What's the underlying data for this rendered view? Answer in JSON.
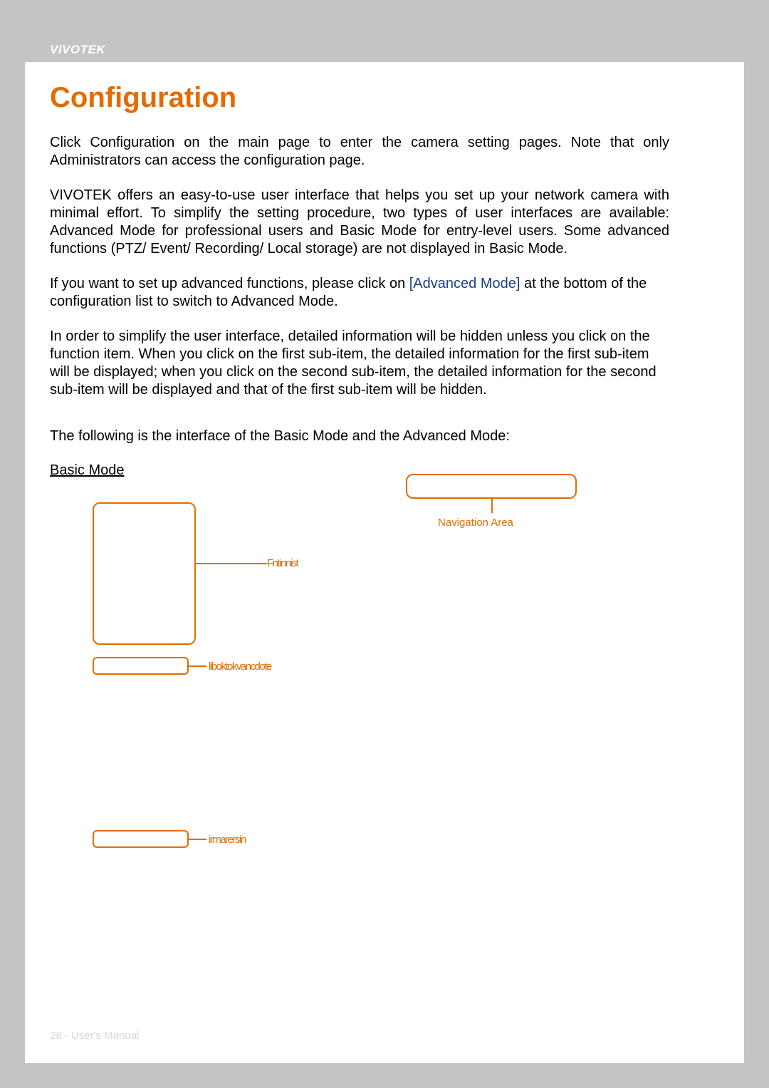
{
  "header": {
    "brand": "VIVOTEK"
  },
  "title": "Configuration",
  "paragraphs": {
    "p1": "Click Configuration   on the main page to enter the camera setting pages. Note that only Administrators can access the configuration page.",
    "p2": "VIVOTEK offers an easy-to-use user interface that helps you set up your network camera with minimal effort. To simplify the setting procedure, two types of user interfaces are available: Advanced Mode for professional users and Basic Mode for entry-level users. Some advanced functions (PTZ/ Event/ Recording/ Local storage) are not displayed in Basic Mode.",
    "p3_a": "If you want to set up advanced functions, please click on ",
    "p3_link": "[Advanced Mode]",
    "p3_b": " at the bottom of the configuration list to switch to Advanced Mode.",
    "p4": "In order to simplify the user interface, detailed information will be hidden unless you click on the function item. When you click on the first sub-item, the detailed information for the first sub-item will be displayed; when you click on the second sub-item, the detailed information for the second sub-item will be displayed and that of the first sub-item will be hidden.",
    "p5": "The following is the interface of the Basic Mode and the Advanced Mode:"
  },
  "section_label": "Basic Mode ",
  "diagram": {
    "navigation_area": "Navigation Area",
    "function_list": "Fntinnist",
    "switch_mode": "liboktokvancdote",
    "firmware": "irmarersin"
  },
  "footer": {
    "page": "28 - User's Manual"
  }
}
